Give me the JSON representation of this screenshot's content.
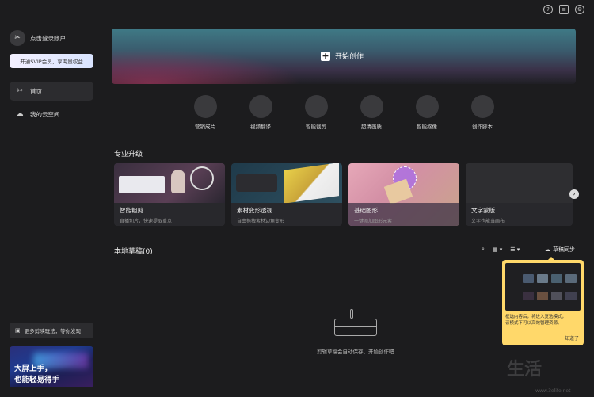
{
  "topbar": {
    "help_icon": "?",
    "feedback_icon": "≡",
    "settings_icon": "⚙"
  },
  "sidebar": {
    "account": {
      "avatar_glyph": "✂",
      "login_label": "点击登录账户"
    },
    "vip_label": "开通SVIP会员，享海量权益",
    "items": [
      {
        "icon": "✂",
        "label": "首页"
      },
      {
        "icon": "☁",
        "label": "我的云空间"
      }
    ],
    "explore_label": "更多剪映玩法，等你发现",
    "promo": {
      "line1": "大屏上手，",
      "line2": "也能轻易得手"
    }
  },
  "hero": {
    "plus_glyph": "+",
    "label": "开始创作"
  },
  "tools": [
    {
      "label": "营销成片"
    },
    {
      "label": "视频翻译"
    },
    {
      "label": "智能裁剪"
    },
    {
      "label": "超清画质"
    },
    {
      "label": "智能抠像"
    },
    {
      "label": "创作脚本"
    }
  ],
  "upgrade": {
    "title": "专业升级",
    "cards": [
      {
        "title": "智能粗剪",
        "subtitle": "直播切片，快速提取重点"
      },
      {
        "title": "素材变形透视",
        "subtitle": "自由拖拽素材边角变形"
      },
      {
        "title": "基础图形",
        "subtitle": "一键添加图形元素"
      },
      {
        "title": "文字蒙版",
        "subtitle": "文字也能当画布"
      }
    ],
    "next_glyph": "›"
  },
  "drafts": {
    "title": "本地草稿(0)",
    "sync_label": "草稿同步",
    "empty_text": "剪辑草稿会自动保存，开始创作吧"
  },
  "tooltip": {
    "line1": "框选内容后，将进入复选模式，",
    "line2": "该模式下可以高效管理资源。",
    "ok_label": "知道了"
  },
  "watermark": {
    "text": "生活",
    "url": "www.3elife.net"
  }
}
